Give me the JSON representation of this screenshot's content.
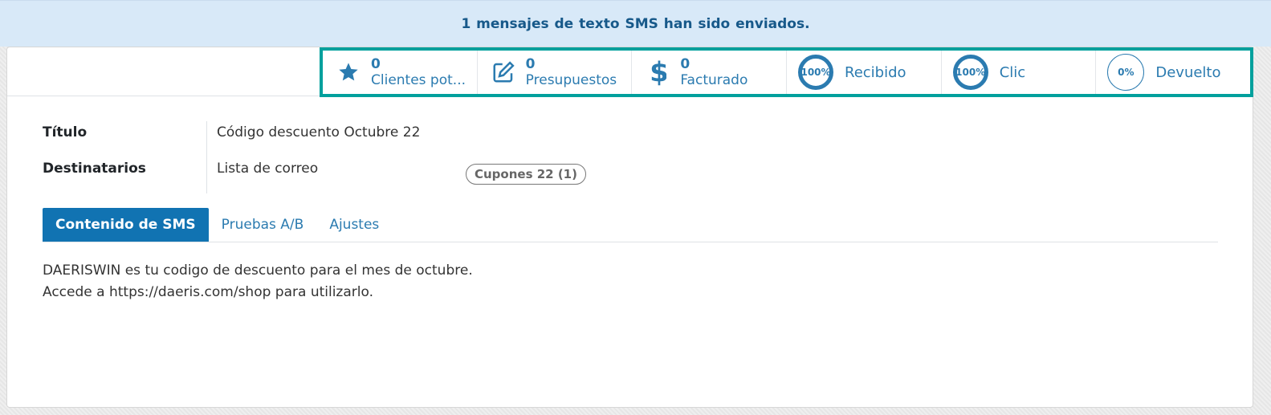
{
  "banner": {
    "message": "1  mensajes de texto SMS han sido enviados."
  },
  "stats": [
    {
      "icon": "star-icon",
      "value": "0",
      "label": "Clientes pot..."
    },
    {
      "icon": "edit-icon",
      "value": "0",
      "label": "Presupuestos"
    },
    {
      "icon": "dollar-icon",
      "value": "0",
      "label": "Facturado"
    }
  ],
  "gauges": [
    {
      "percent_text": "100%",
      "label": "Recibido",
      "fill": 1.0
    },
    {
      "percent_text": "100%",
      "label": "Clic",
      "fill": 1.0
    },
    {
      "percent_text": "0%",
      "label": "Devuelto",
      "fill": 0.0
    }
  ],
  "fields": {
    "title_label": "Título",
    "title_value": "Código descuento Octubre 22",
    "recipients_label": "Destinatarios",
    "recipients_value": "Lista de correo",
    "recipients_tag": "Cupones 22 (1)"
  },
  "tabs": [
    "Contenido de SMS",
    "Pruebas A/B",
    "Ajustes"
  ],
  "content": {
    "line1": "DAERISWIN es tu codigo de descuento para el mes de octubre.",
    "line2": "Accede a https://daeris.com/shop para utilizarlo."
  },
  "colors": {
    "accent": "#2b7bb0",
    "highlight_frame": "#00a09d",
    "active_tab": "#1173b2"
  }
}
